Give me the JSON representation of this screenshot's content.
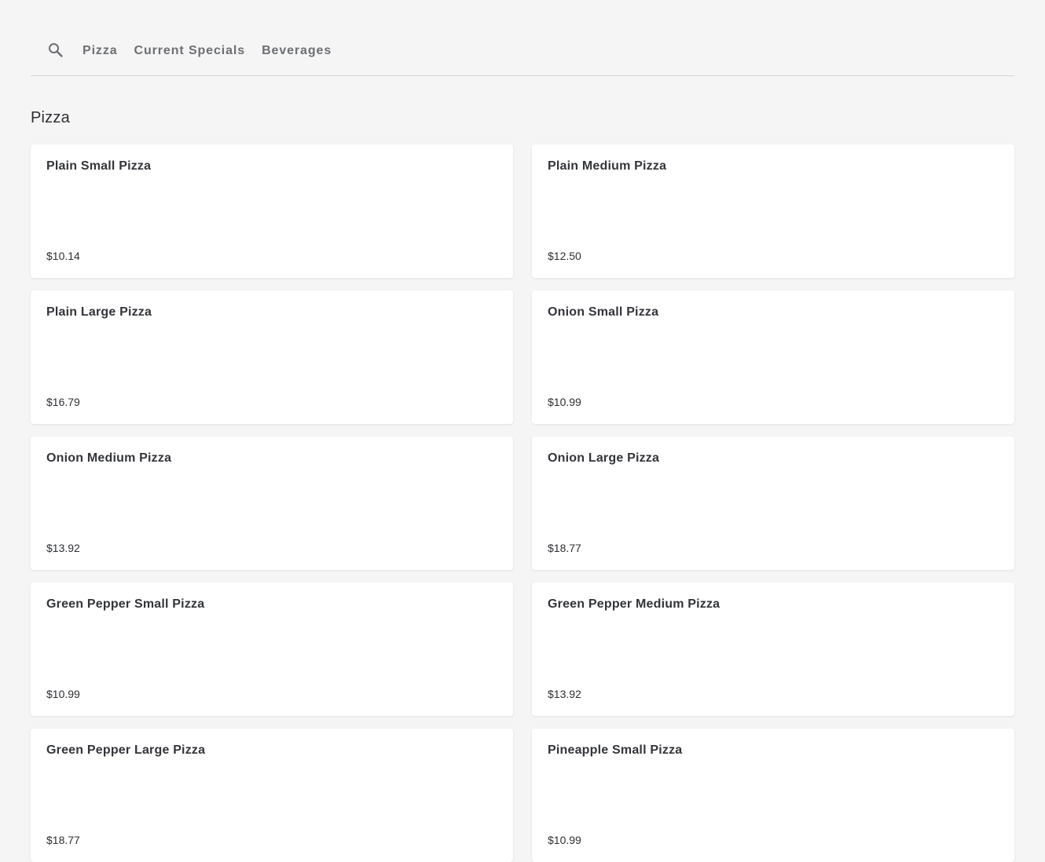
{
  "nav": {
    "search_icon": "search-icon",
    "tabs": [
      {
        "label": "Pizza"
      },
      {
        "label": "Current Specials"
      },
      {
        "label": "Beverages"
      }
    ]
  },
  "section": {
    "title": "Pizza"
  },
  "items": [
    {
      "name": "Plain Small Pizza",
      "price": "$10.14"
    },
    {
      "name": "Plain Medium Pizza",
      "price": "$12.50"
    },
    {
      "name": "Plain Large Pizza",
      "price": "$16.79"
    },
    {
      "name": "Onion Small Pizza",
      "price": "$10.99"
    },
    {
      "name": "Onion Medium Pizza",
      "price": "$13.92"
    },
    {
      "name": "Onion Large Pizza",
      "price": "$18.77"
    },
    {
      "name": "Green Pepper Small Pizza",
      "price": "$10.99"
    },
    {
      "name": "Green Pepper Medium Pizza",
      "price": "$13.92"
    },
    {
      "name": "Green Pepper Large Pizza",
      "price": "$18.77"
    },
    {
      "name": "Pineapple Small Pizza",
      "price": "$10.99"
    }
  ],
  "colors": {
    "background": "#f5f5f5",
    "card": "#ffffff",
    "tab_text": "#6d6f74",
    "text": "#2d2f33"
  }
}
